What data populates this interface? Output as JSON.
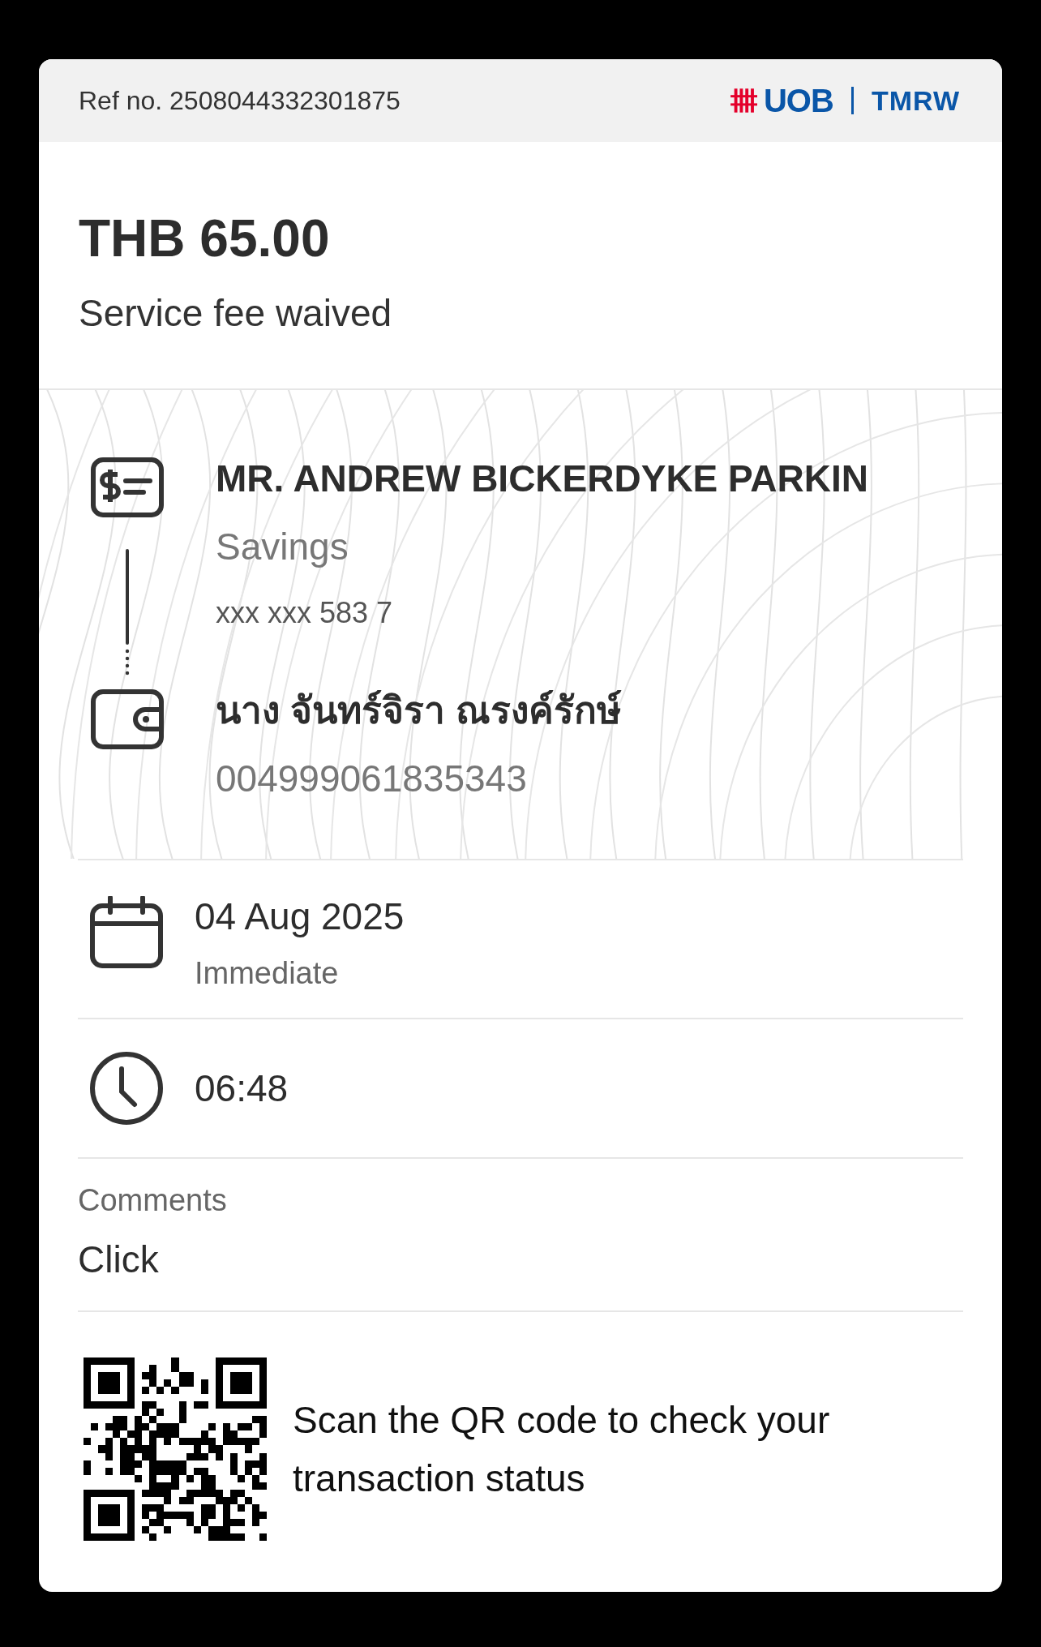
{
  "header": {
    "ref": "Ref no. 2508044332301875",
    "logo": {
      "brand": "UOB",
      "product": "TMRW"
    }
  },
  "amount": "THB 65.00",
  "fee_note": "Service fee waived",
  "transfer": {
    "from": {
      "name": "MR. ANDREW BICKERDYKE PARKIN",
      "account_type": "Savings",
      "account_number": "xxx xxx 583 7"
    },
    "to": {
      "name": "นาง จันทร์จิรา ณรงค์รักษ์",
      "account_number": "004999061835343"
    }
  },
  "date": {
    "value": "04 Aug 2025",
    "timing": "Immediate"
  },
  "time": "06:48",
  "comments": {
    "label": "Comments",
    "value": "Click"
  },
  "qr": {
    "caption": "Scan the QR code to check your transaction status"
  }
}
